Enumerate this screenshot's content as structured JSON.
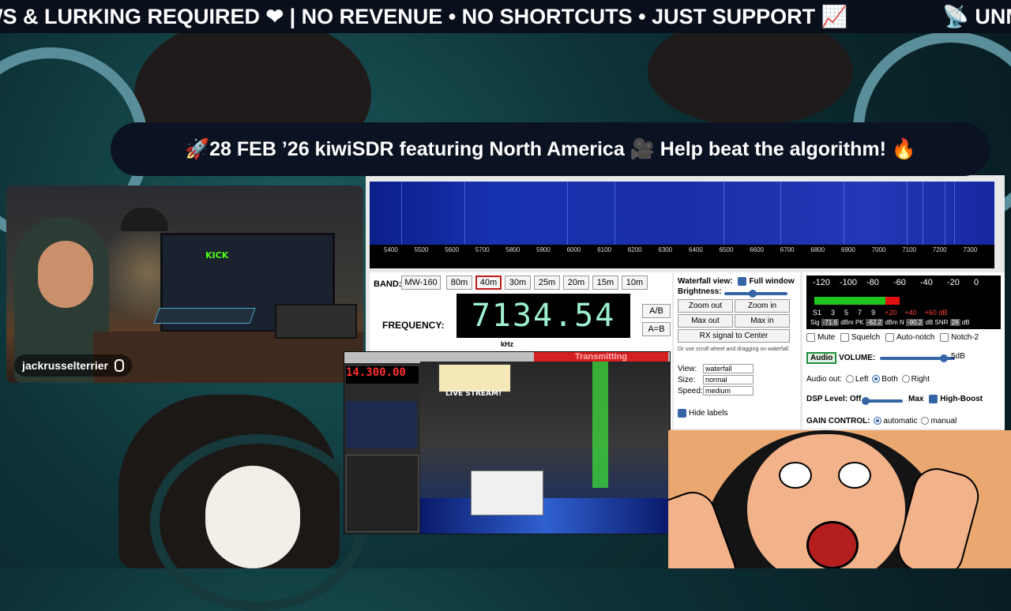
{
  "ticker": {
    "text_left": "WS & LURKING REQUIRED ❤ | NO REVENUE • NO SHORTCUTS • JUST SUPPORT 📈",
    "text_right": "📡 UNMA"
  },
  "banner": {
    "text": "🚀28 FEB ’26 kiwiSDR featuring North America 🎥 Help beat the algorithm! 🔥"
  },
  "webcam": {
    "username": "jackrusselterrier",
    "screen_brand": "KICK"
  },
  "kiwisdr": {
    "freq_scale": [
      "5400",
      "5500",
      "5600",
      "5700",
      "5800",
      "5900",
      "6000",
      "6100",
      "6200",
      "6300",
      "6400",
      "6500",
      "6600",
      "6700",
      "6800",
      "6900",
      "7000",
      "7100",
      "7200",
      "7300"
    ],
    "band_label": "BAND:",
    "bands": [
      {
        "label": "MW-160",
        "selected": false
      },
      {
        "label": "80m",
        "selected": false
      },
      {
        "label": "40m",
        "selected": true
      },
      {
        "label": "30m",
        "selected": false
      },
      {
        "label": "25m",
        "selected": false
      },
      {
        "label": "20m",
        "selected": false
      },
      {
        "label": "15m",
        "selected": false
      },
      {
        "label": "10m",
        "selected": false
      }
    ],
    "frequency_label": "FREQUENCY:",
    "frequency_value": "7134.54",
    "frequency_unit": "kHz",
    "ab_button": "A/B",
    "aeqb_button": "A=B",
    "waterfall": {
      "view_label": "Waterfall view:",
      "full_window_label": "Full window",
      "full_window_checked": true,
      "brightness_label": "Brightness:",
      "brightness_level": 0.45,
      "zoom_out": "Zoom out",
      "zoom_in": "Zoom in",
      "max_out": "Max out",
      "max_in": "Max in",
      "rx_center": "RX signal to Center",
      "hint": "Or use scroll wheel and dragging on waterfall.",
      "view_opt_label": "View:",
      "view_opt_value": "waterfall",
      "size_label": "Size:",
      "size_value": "normal",
      "speed_label": "Speed:",
      "speed_value": "medium",
      "hide_labels": "Hide labels",
      "hide_labels_checked": true
    },
    "audio": {
      "smeter_scale": [
        "-120",
        "-100",
        "-80",
        "-60",
        "-40",
        "-20",
        "0"
      ],
      "smeter_s": [
        "S1",
        "3",
        "5",
        "7",
        "9"
      ],
      "smeter_plus": [
        "+20",
        "+40",
        "+60 dB"
      ],
      "sig_label": "Sig",
      "sig_value": "-71.6",
      "dbm1": "dBm",
      "pk_label": "PK",
      "pk_value": "-62.2",
      "dbm2": "dBm",
      "n_label": "N",
      "n_value": "-90.2",
      "db": "dB",
      "snr_label": "SNR",
      "snr_value": "28",
      "db2": "dB",
      "mute": "Mute",
      "squelch": "Squelch",
      "autonotch": "Auto-notch",
      "notch2": "Notch-2",
      "audio_btn": "Audio",
      "volume_label": "VOLUME:",
      "volume_value": "5dB",
      "volume_level": 0.85,
      "audio_out_label": "Audio out:",
      "out_left": "Left",
      "out_both": "Both",
      "out_right": "Right",
      "dsp_label": "DSP Level:",
      "dsp_off": "Off",
      "dsp_max": "Max",
      "high_boost": "High-Boost",
      "high_boost_checked": true,
      "gain_label": "GAIN CONTROL:",
      "gain_auto": "automatic",
      "gain_manual": "manual"
    }
  },
  "sdr_software": {
    "frequency": "14.300.00",
    "transmitting": "Transmitting",
    "live_stream": "LIVE STREAM!"
  },
  "colors": {
    "ticker_bg": "#0a0f1c",
    "banner_bg": "#0b1322",
    "freq_text": "#9ef0cf",
    "selected_band_border": "#c01818"
  }
}
